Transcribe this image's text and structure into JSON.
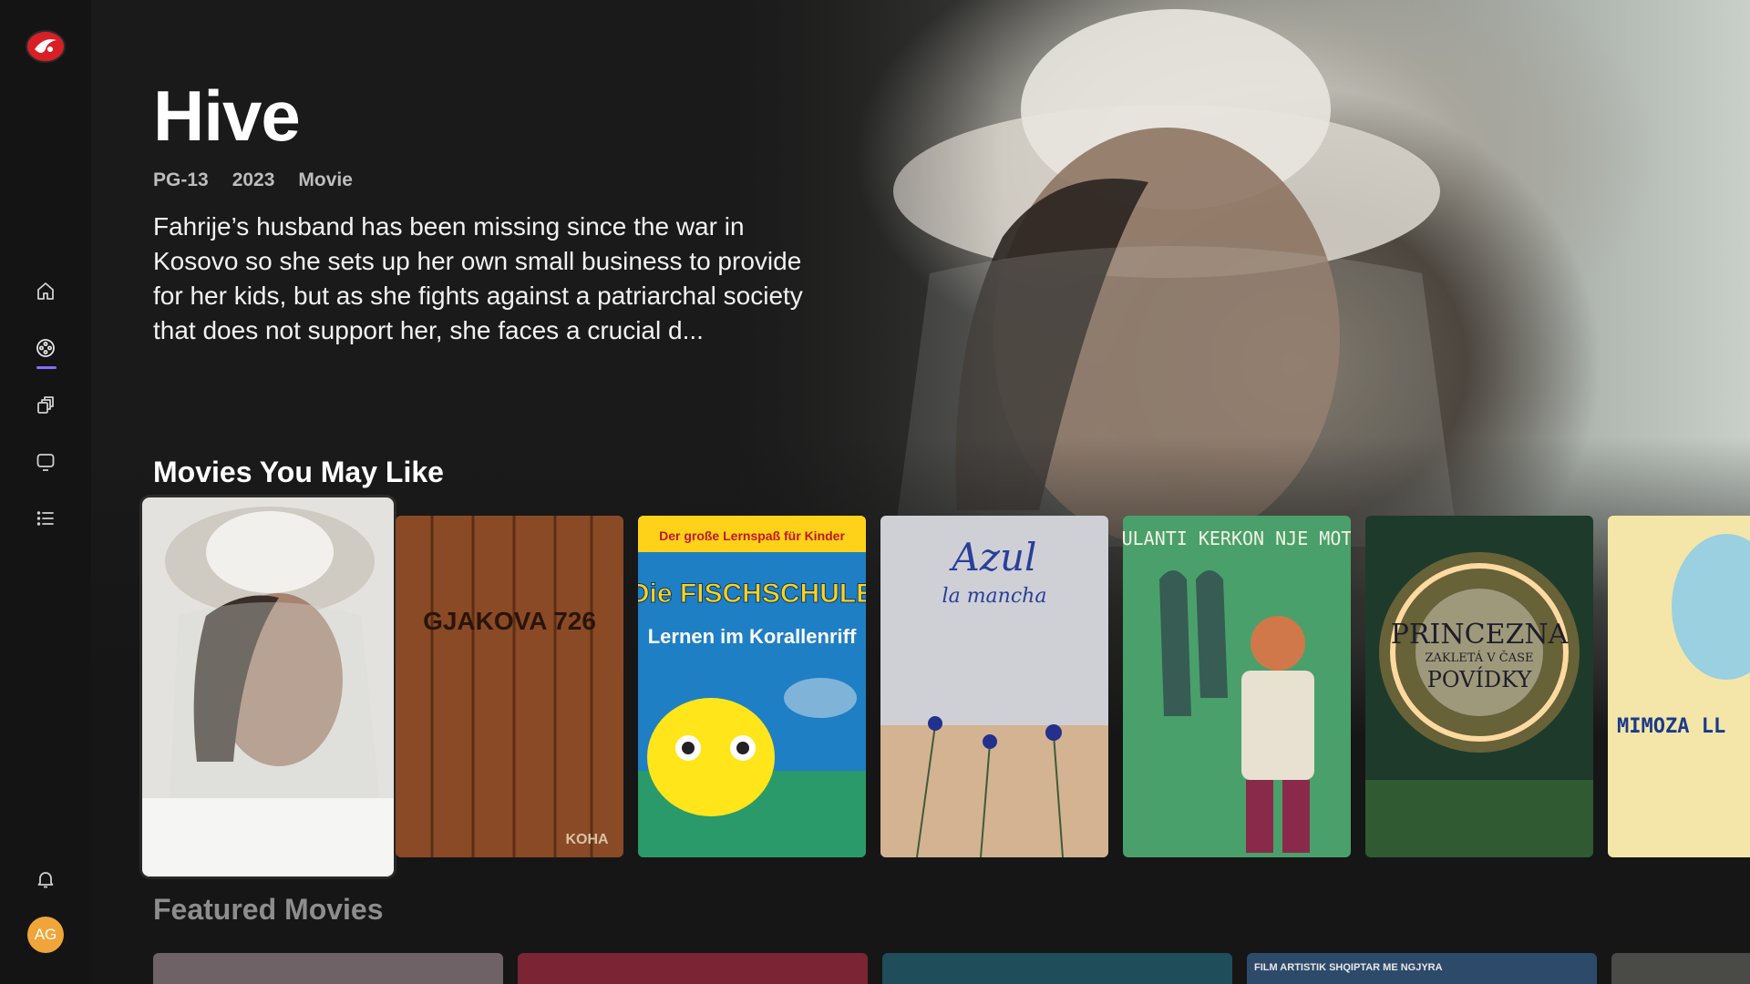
{
  "app": {
    "brand_color": "#d81f26",
    "accent": "#8a6bff"
  },
  "sidebar": {
    "items": [
      {
        "name": "home",
        "icon": "home-icon"
      },
      {
        "name": "movies",
        "icon": "film-reel-icon",
        "active": true
      },
      {
        "name": "series",
        "icon": "library-stack-icon"
      },
      {
        "name": "live-tv",
        "icon": "tv-icon"
      },
      {
        "name": "my-list",
        "icon": "list-icon"
      }
    ],
    "notifications_icon": "bell-icon",
    "avatar_initials": "AG",
    "avatar_color": "#f0a53a"
  },
  "hero": {
    "title": "Hive",
    "rating": "PG-13",
    "year": "2023",
    "type": "Movie",
    "description": "Fahrije’s husband has been missing since the war in Kosovo so she sets up her own small business to provide for her kids, but as she fights against a patriarchal society that does not support her, she faces a crucial d..."
  },
  "rows": [
    {
      "title": "Movies You May Like",
      "items": [
        {
          "poster_text": ""
        },
        {
          "poster_text": "GJAKOVA 726",
          "footer": "KOHA"
        },
        {
          "poster_text_top": "Der große Lernspaß für Kinder",
          "poster_text": "Die FISCHSCHULE",
          "poster_sub": "Lernen im Korallenriff"
        },
        {
          "poster_text": "Azul",
          "poster_sub": "la mancha"
        },
        {
          "poster_text": "TAULANTI KERKON NJE MOTER"
        },
        {
          "poster_text": "PRINCEZNA",
          "poster_sub": "ZAKLETÁ V ČASE",
          "poster_sub2": "POVÍDKY"
        },
        {
          "poster_text": "MIMOZA LL"
        }
      ]
    },
    {
      "title": "Featured Movies",
      "items": [
        {
          "color": "#6e6266"
        },
        {
          "color": "#7a2434"
        },
        {
          "color": "#1f4d5a"
        },
        {
          "color": "#2e4a6b",
          "poster_text": "FILM ARTISTIK SHQIPTAR ME NGJYRA"
        },
        {
          "color": "#4a4a46"
        }
      ]
    }
  ]
}
